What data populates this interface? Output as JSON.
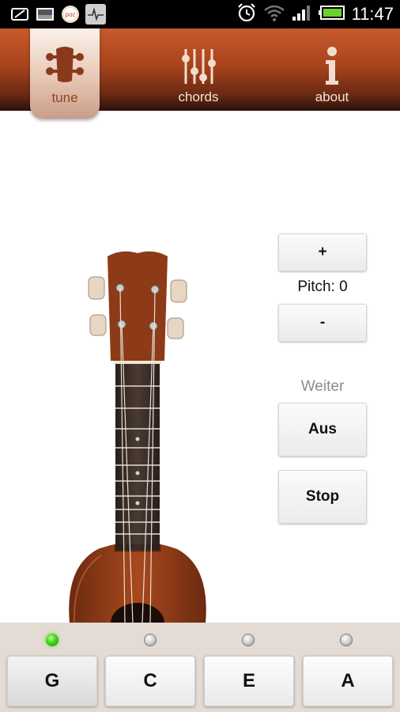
{
  "status_bar": {
    "time": "11:47",
    "left_icons": [
      "notification-icon",
      "gallery-icon",
      "pocket-icon",
      "pulse-icon"
    ],
    "right_icons": [
      "alarm-icon",
      "wifi-icon",
      "signal-icon",
      "battery-icon"
    ]
  },
  "nav": {
    "tabs": [
      {
        "label": "tune",
        "icon": "ukulele-headstock-icon",
        "active": true
      },
      {
        "label": "chords",
        "icon": "sliders-icon",
        "active": false
      },
      {
        "label": "about",
        "icon": "info-icon",
        "active": false
      }
    ]
  },
  "controls": {
    "pitch_up": "+",
    "pitch_label": "Pitch: 0",
    "pitch_down": "-",
    "continue_label": "Weiter",
    "off_button": "Aus",
    "stop_button": "Stop"
  },
  "strings": [
    {
      "note": "G",
      "active": true
    },
    {
      "note": "C",
      "active": false
    },
    {
      "note": "E",
      "active": false
    },
    {
      "note": "A",
      "active": false
    }
  ],
  "colors": {
    "nav_top": "#c75a2c",
    "nav_bottom": "#2a120a",
    "active_led": "#3fd11c",
    "ukulele_wood": "#8a3a1a"
  }
}
